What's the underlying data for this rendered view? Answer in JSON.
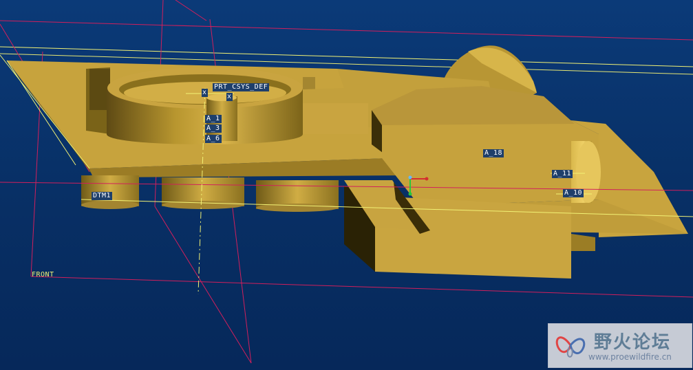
{
  "viewport": {
    "background_color": "#083066",
    "model_color": "#c9a440",
    "datum_plane_color": "#d21f5c",
    "axis_color": "#f2f275"
  },
  "labels": {
    "csys": "PRT_CSYS_DEF",
    "csys_marker": "x",
    "axis_a1": "A_1",
    "axis_a3": "A_3",
    "axis_a6": "A_6",
    "axis_a18": "A_18",
    "axis_a11": "A_11",
    "axis_a10": "A_10",
    "plane_dtm1": "DTM1",
    "plane_front": "FRONT"
  },
  "watermark": {
    "title": "野火论坛",
    "url": "www.proewildfire.cn",
    "logo_icon": "butterfly-logo-icon"
  }
}
